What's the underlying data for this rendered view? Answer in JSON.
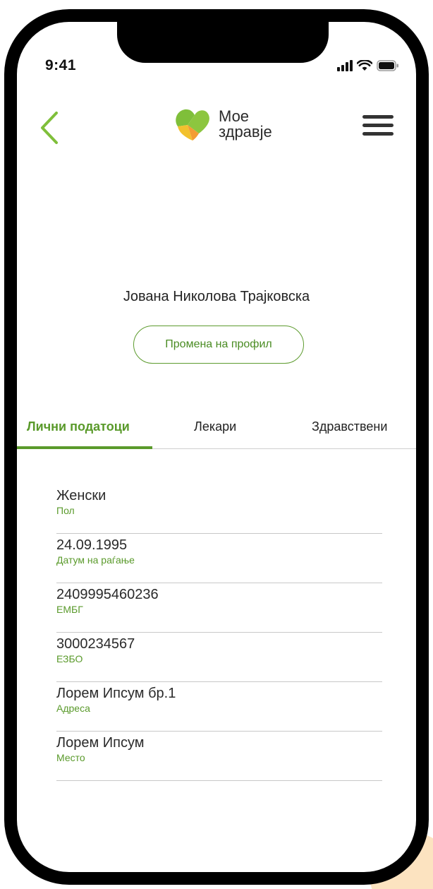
{
  "status": {
    "time": "9:41",
    "icons": [
      "signal-icon",
      "wifi-icon",
      "battery-icon"
    ]
  },
  "header": {
    "back_icon": "chevron-left-icon",
    "logo_line1": "Мое",
    "logo_line2": "здравје",
    "menu_icon": "hamburger-menu-icon"
  },
  "profile": {
    "name": "Јована Николова Трајковска",
    "edit_button": "Промена на профил"
  },
  "tabs": [
    {
      "label": "Лични податоци",
      "active": true
    },
    {
      "label": "Лекари",
      "active": false
    },
    {
      "label": "Здравствени",
      "active": false
    }
  ],
  "info": [
    {
      "value": "Женски",
      "label": "Пол"
    },
    {
      "value": "24.09.1995",
      "label": "Датум на раѓање"
    },
    {
      "value": "2409995460236",
      "label": "ЕМБГ"
    },
    {
      "value": "3000234567",
      "label": "ЕЗБО"
    },
    {
      "value": "Лорем Ипсум бр.1",
      "label": "Адреса"
    },
    {
      "value": "Лорем Ипсум",
      "label": "Место"
    }
  ],
  "colors": {
    "accent_green": "#5a9a2b",
    "logo_green": "#8cc63f",
    "logo_yellow": "#f2c12e",
    "logo_orange": "#f39c33"
  }
}
